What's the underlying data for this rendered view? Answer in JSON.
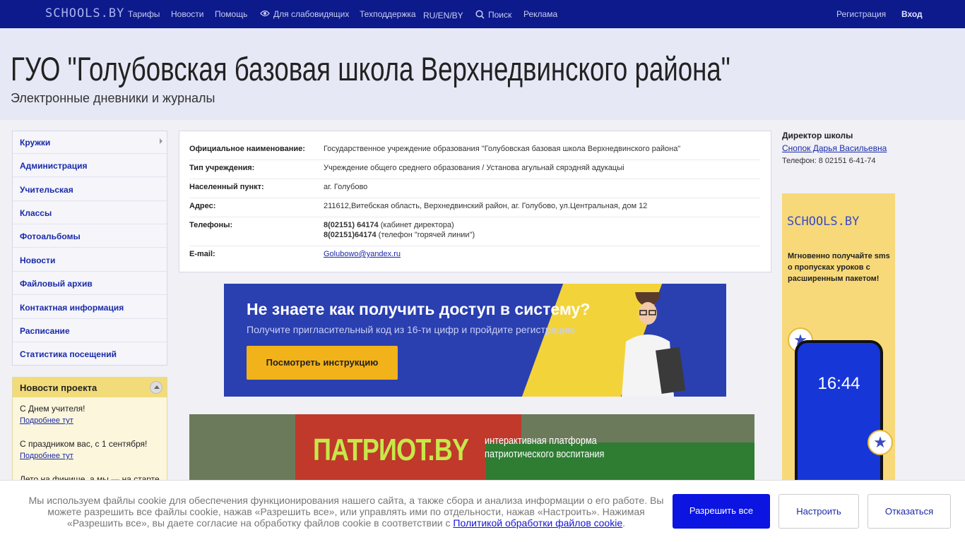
{
  "topbar": {
    "logo": "SCHOOLS.BY",
    "links": [
      "Тарифы",
      "Новости",
      "Помощь",
      "Для слабовидящих",
      "Техподдержка",
      "RU/EN/BY",
      "Поиск",
      "Реклама"
    ],
    "register": "Регистрация",
    "login": "Вход"
  },
  "header": {
    "title": "ГУО \"Голубовская базовая школа Верхнедвинского района\"",
    "subtitle": "Электронные дневники и журналы"
  },
  "sidebar": {
    "items": [
      "Кружки",
      "Администрация",
      "Учительская",
      "Классы",
      "Фотоальбомы",
      "Новости",
      "Файловый архив",
      "Контактная информация",
      "Расписание",
      "Статистика посещений"
    ]
  },
  "news": {
    "title": "Новости проекта",
    "items": [
      {
        "text": "С Днем учителя!",
        "more": "Подробнее тут"
      },
      {
        "text": "С праздником вас, с 1 сентября!",
        "more": "Подробнее тут"
      },
      {
        "text": "Лето на финише, а мы — на старте"
      }
    ]
  },
  "info": {
    "rows": [
      {
        "label": "Официальное наименование:",
        "value": "Государственное учреждение образования \"Голубовская базовая школа Верхнедвинского района\""
      },
      {
        "label": "Тип учреждения:",
        "value": "Учреждение общего среднего образования / Установа агульнай сярэдняй адукацыі"
      },
      {
        "label": "Населенный пункт:",
        "value": "аг. Голубово"
      },
      {
        "label": "Адрес:",
        "value": "211612,Витебская область, Верхнедвинский район, аг. Голубово, ул.Центральная, дом 12"
      }
    ],
    "phones_label": "Телефоны:",
    "phone1": "8(02151) 64174",
    "phone1_note": " (кабинет директора)",
    "phone2": "8(02151)64174",
    "phone2_note": " (телефон \"горячей линии\")",
    "email_label": "E-mail:",
    "email": "Golubowo@yandex.ru"
  },
  "banner1": {
    "title": "Не знаете как получить доступ в систему?",
    "subtitle": "Получите пригласительный код из 16-ти цифр и пройдите регистрацию",
    "button": "Посмотреть инструкцию"
  },
  "banner2": {
    "title": "ПАТРИОТ.BY",
    "subtitle_l1": "интерактивная платформа",
    "subtitle_l2": "патриотического воспитания"
  },
  "director": {
    "heading": "Директор школы",
    "name": "Снопок Дарья Васильевна",
    "phone": "Телефон: 8 02151 6-41-74"
  },
  "ad": {
    "logo": "SCHOOLS.BY",
    "text": "Мгновенно получайте sms о пропусках уроков с расширенным пакетом!",
    "time": "16:44"
  },
  "cookie": {
    "text": "Мы используем файлы cookie для обеспечения функционирования нашего сайта, а также сбора и анализа информации о его работе. Вы можете разрешить все файлы cookie, нажав «Разрешить все», или управлять ими по отдельности, нажав «Настроить». Нажимая «Разрешить все», вы даете согласие на обработку файлов cookie в соответствии с ",
    "link": "Политикой обработки файлов cookie",
    "end": ".",
    "allow": "Разрешить все",
    "configure": "Настроить",
    "deny": "Отказаться"
  },
  "colors": {
    "topbar": "#0d1a8c",
    "accent": "#0b14e0",
    "link": "#1a2aa8",
    "news_header": "#f2dc7a"
  }
}
